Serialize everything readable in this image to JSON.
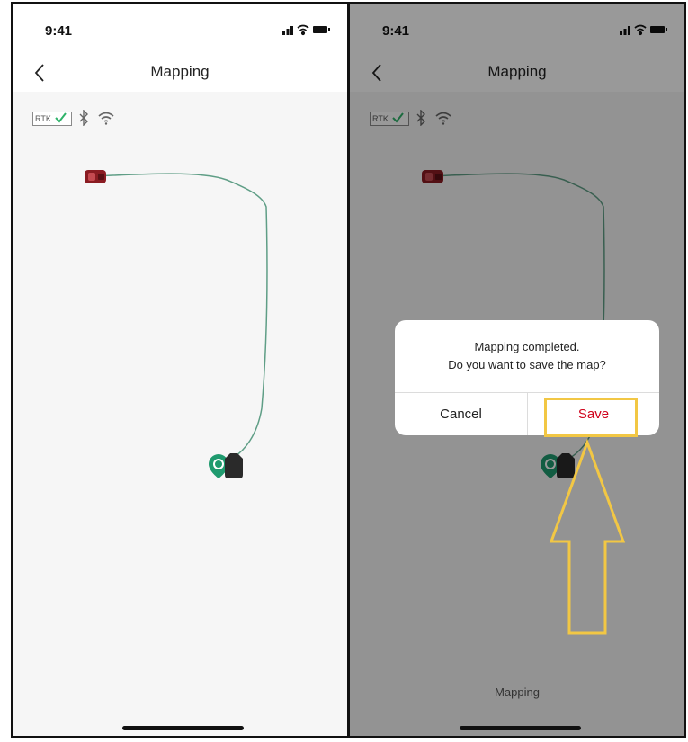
{
  "status_bar": {
    "time": "9:41"
  },
  "nav": {
    "title": "Mapping"
  },
  "connectivity": {
    "rtk_label": "RTK"
  },
  "dialog": {
    "message_line1": "Mapping completed.",
    "message_line2": "Do you want to save the map?",
    "cancel_label": "Cancel",
    "save_label": "Save"
  },
  "bottom_status": "Mapping",
  "colors": {
    "route": "#5f9e86",
    "save_text": "#d0021b",
    "highlight": "#f2c744",
    "location_pin": "#1f9a6e",
    "mower": "#8a1c22",
    "rtk_check": "#2fb36a"
  },
  "icons": [
    "back-icon",
    "signal-icon",
    "wifi-icon",
    "battery-icon",
    "bluetooth-icon",
    "location-pin-icon",
    "mower-icon",
    "charging-station-icon",
    "arrow-up-annotation"
  ]
}
